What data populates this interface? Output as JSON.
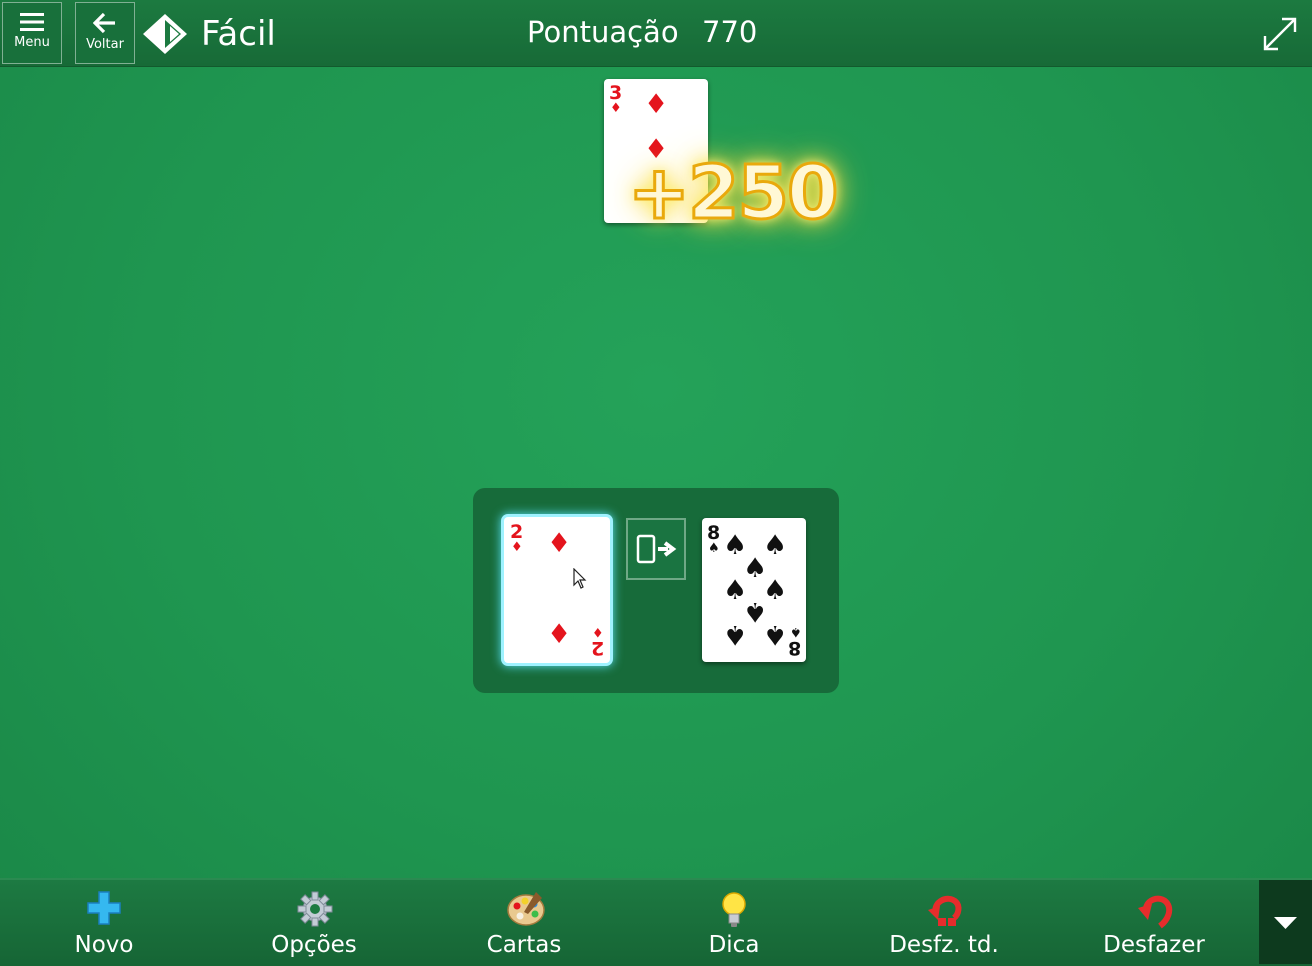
{
  "header": {
    "menu_label": "Menu",
    "back_label": "Voltar",
    "difficulty": "Fácil",
    "score_label": "Pontuação",
    "score_value": "770"
  },
  "score_popup": "+250",
  "cards": {
    "top_card": {
      "rank": "3",
      "suit": "♦",
      "color": "#e4141d"
    },
    "waste_card": {
      "rank": "2",
      "suit": "♦",
      "color": "#e4141d",
      "selected": true
    },
    "right_card": {
      "rank": "8",
      "suit": "♠",
      "color": "#111111"
    }
  },
  "toolbar": {
    "items": [
      {
        "label": "Novo",
        "icon": "plus-icon"
      },
      {
        "label": "Opções",
        "icon": "gear-icon"
      },
      {
        "label": "Cartas",
        "icon": "palette-icon"
      },
      {
        "label": "Dica",
        "icon": "lightbulb-icon"
      },
      {
        "label": "Desfz. td.",
        "icon": "undo-all-icon"
      },
      {
        "label": "Desfazer",
        "icon": "undo-icon"
      }
    ]
  },
  "colors": {
    "felt": "#1f9650",
    "bar": "#176a37",
    "accent_cyan": "#58e0f5",
    "gold": "#e9a90c"
  }
}
